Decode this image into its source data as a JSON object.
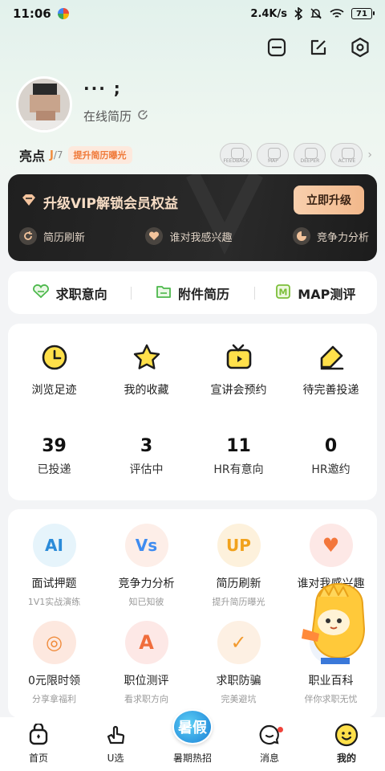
{
  "status_bar": {
    "time": "11:06",
    "network_speed": "2.4K/s",
    "battery": "71"
  },
  "profile": {
    "username": "··· ;",
    "online_resume": "在线简历"
  },
  "highlights": {
    "title": "亮点",
    "count_current": "J",
    "count_total": "/7",
    "tag": "提升简历曝光",
    "badges": [
      "FEEDBACK",
      "MAP",
      "DEEPER",
      "ACTIVE"
    ]
  },
  "vip": {
    "title": "升级VIP解锁会员权益",
    "button": "立即升级",
    "features": [
      {
        "label": "简历刷新",
        "icon": "refresh-icon"
      },
      {
        "label": "谁对我感兴趣",
        "icon": "heart-icon"
      },
      {
        "label": "竞争力分析",
        "icon": "pie-chart-icon"
      }
    ]
  },
  "quick_links": [
    {
      "label": "求职意向",
      "icon": "heart-outline-icon",
      "color": "#4cb84c"
    },
    {
      "label": "附件简历",
      "icon": "folder-icon",
      "color": "#4cb84c"
    },
    {
      "label": "MAP测评",
      "icon": "map-test-icon",
      "color": "#4cb84c"
    }
  ],
  "activity": [
    {
      "label": "浏览足迹",
      "icon": "clock-icon"
    },
    {
      "label": "我的收藏",
      "icon": "star-icon"
    },
    {
      "label": "宣讲会预约",
      "icon": "tv-icon"
    },
    {
      "label": "待完善投递",
      "icon": "edit-tag-icon"
    }
  ],
  "stats": [
    {
      "value": "39",
      "label": "已投递"
    },
    {
      "value": "3",
      "label": "评估中"
    },
    {
      "value": "11",
      "label": "HR有意向"
    },
    {
      "value": "0",
      "label": "HR邀约"
    }
  ],
  "services": [
    {
      "title": "面试押题",
      "sub": "1V1实战演练",
      "icon": "ai-icon",
      "bg": "#e6f4fb",
      "fg": "#2b8bd9",
      "glyph": "AI"
    },
    {
      "title": "竞争力分析",
      "sub": "知已知彼",
      "icon": "vs-icon",
      "bg": "#fdeee8",
      "fg": "#3f8cf0",
      "glyph": "Vs"
    },
    {
      "title": "简历刷新",
      "sub": "提升简历曝光",
      "icon": "up-icon",
      "bg": "#fdf1dc",
      "fg": "#f1a21d",
      "glyph": "UP"
    },
    {
      "title": "谁对我感兴趣",
      "sub": "",
      "icon": "heart-icon",
      "bg": "#fde8e6",
      "fg": "#f3773c",
      "glyph": "♥"
    },
    {
      "title": "0元限时领",
      "sub": "分享拿福利",
      "icon": "gift-icon",
      "bg": "#fde8df",
      "fg": "#f08a3a",
      "glyph": "◎"
    },
    {
      "title": "职位测评",
      "sub": "看求职方向",
      "icon": "document-a-icon",
      "bg": "#fde8e6",
      "fg": "#f06d3c",
      "glyph": "A"
    },
    {
      "title": "求职防骗",
      "sub": "完美避坑",
      "icon": "shield-icon",
      "bg": "#fdf0e3",
      "fg": "#f29a2e",
      "glyph": "✓"
    },
    {
      "title": "职业百科",
      "sub": "伴你求职无忧",
      "icon": "book-icon",
      "bg": "#eef3fb",
      "fg": "#4a8ee8",
      "glyph": "▤"
    }
  ],
  "tabbar": [
    {
      "label": "首页",
      "icon": "home-bag-icon"
    },
    {
      "label": "U选",
      "icon": "hand-heart-icon"
    },
    {
      "label": "暑期热招",
      "icon": "summer-badge-icon",
      "badge_text": "暑假"
    },
    {
      "label": "消息",
      "icon": "message-icon"
    },
    {
      "label": "我的",
      "icon": "smiley-icon"
    }
  ]
}
